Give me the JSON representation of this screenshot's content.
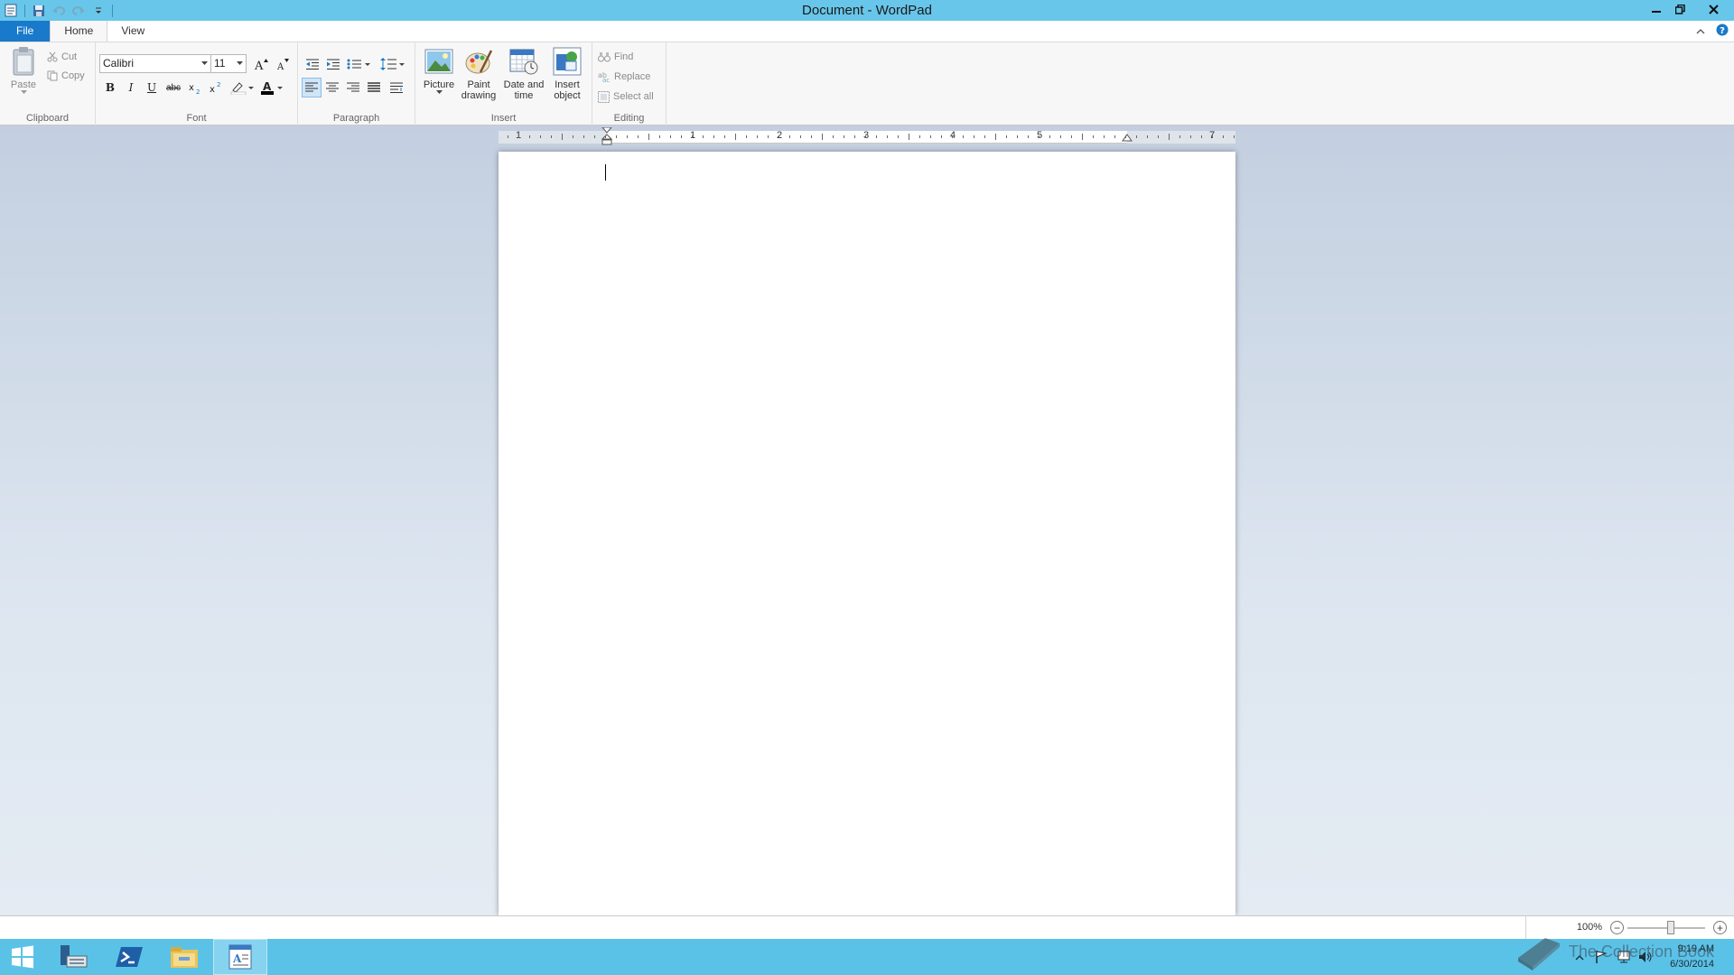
{
  "window": {
    "title": "Document - WordPad"
  },
  "quick_access": {
    "icons": [
      "wordpad-app-icon",
      "save-icon",
      "undo-icon",
      "redo-icon",
      "customize-qat-icon"
    ]
  },
  "tabs": [
    {
      "label": "File"
    },
    {
      "label": "Home"
    },
    {
      "label": "View"
    }
  ],
  "clipboard": {
    "paste": "Paste",
    "cut": "Cut",
    "copy": "Copy",
    "group": "Clipboard"
  },
  "font": {
    "family": "Calibri",
    "size": "11",
    "group": "Font",
    "bold": "B",
    "italic": "I",
    "underline": "U",
    "strike": "abc",
    "color_letter": "A"
  },
  "paragraph": {
    "group": "Paragraph"
  },
  "insert": {
    "group": "Insert",
    "picture": "Picture",
    "paint_line1": "Paint",
    "paint_line2": "drawing",
    "date_line1": "Date and",
    "date_line2": "time",
    "object_line1": "Insert",
    "object_line2": "object"
  },
  "editing": {
    "group": "Editing",
    "find": "Find",
    "replace": "Replace",
    "select_all": "Select all"
  },
  "ruler": {
    "labels": [
      "1",
      "1",
      "2",
      "3",
      "4",
      "5",
      "7"
    ]
  },
  "status": {
    "zoom": "100%"
  },
  "clock": {
    "time": "9:19 AM",
    "date": "6/30/2014"
  },
  "watermark": {
    "text": "The Collection Book"
  },
  "colors": {
    "titlebar": "#68c6ea",
    "file_tab": "#1979ca",
    "taskbar": "#5bc2e7"
  }
}
